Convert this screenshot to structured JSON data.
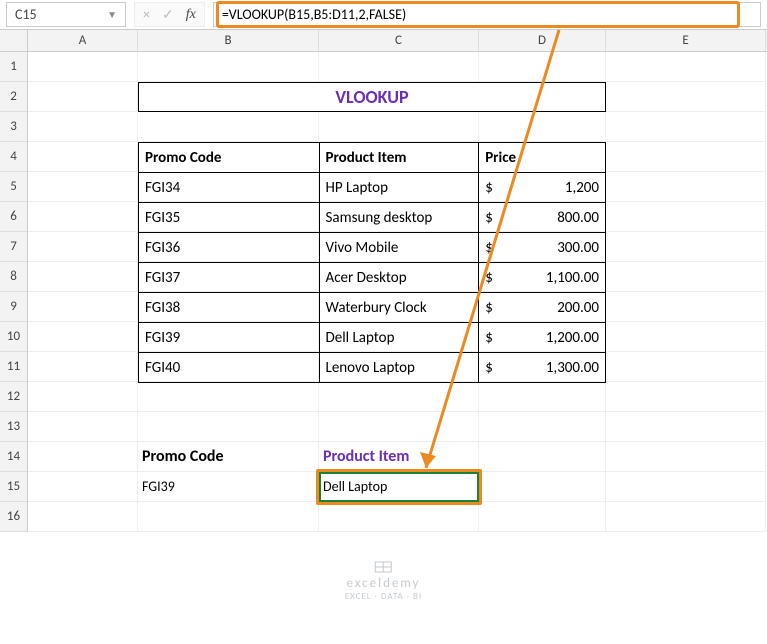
{
  "nameBox": {
    "value": "C15"
  },
  "formulaBar": {
    "cancelIcon": "×",
    "confirmIcon": "✓",
    "fxLabel": "fx",
    "value": "=VLOOKUP(B15,B5:D11,2,FALSE)"
  },
  "columns": [
    "A",
    "B",
    "C",
    "D",
    "E"
  ],
  "rows": [
    "1",
    "2",
    "3",
    "4",
    "5",
    "6",
    "7",
    "8",
    "9",
    "10",
    "11",
    "12",
    "13",
    "14",
    "15",
    "16"
  ],
  "title": "VLOOKUP",
  "tableHeaders": {
    "code": "Promo Code",
    "item": "Product Item",
    "price": "Price"
  },
  "tableRows": [
    {
      "code": "FGI34",
      "item": "HP Laptop",
      "price": "1,200",
      "cur": "$"
    },
    {
      "code": "FGI35",
      "item": "Samsung desktop",
      "price": "800.00",
      "cur": "$"
    },
    {
      "code": "FGI36",
      "item": "Vivo Mobile",
      "price": "300.00",
      "cur": "$"
    },
    {
      "code": "FGI37",
      "item": "Acer Desktop",
      "price": "1,100.00",
      "cur": "$"
    },
    {
      "code": "FGI38",
      "item": "Waterbury Clock",
      "price": "200.00",
      "cur": "$"
    },
    {
      "code": "FGI39",
      "item": "Dell Laptop",
      "price": "1,200.00",
      "cur": "$"
    },
    {
      "code": "FGI40",
      "item": "Lenovo Laptop",
      "price": "1,300.00",
      "cur": "$"
    }
  ],
  "lookup": {
    "codeLabel": "Promo Code",
    "itemLabel": "Product Item",
    "codeValue": "FGI39",
    "resultValue": "Dell Laptop"
  },
  "watermark": {
    "line1": "exceldemy",
    "line2": "EXCEL · DATA · BI"
  },
  "colors": {
    "accent": "#ec8a1f",
    "purple": "#6b2fb3",
    "selection": "#1a7f37"
  }
}
